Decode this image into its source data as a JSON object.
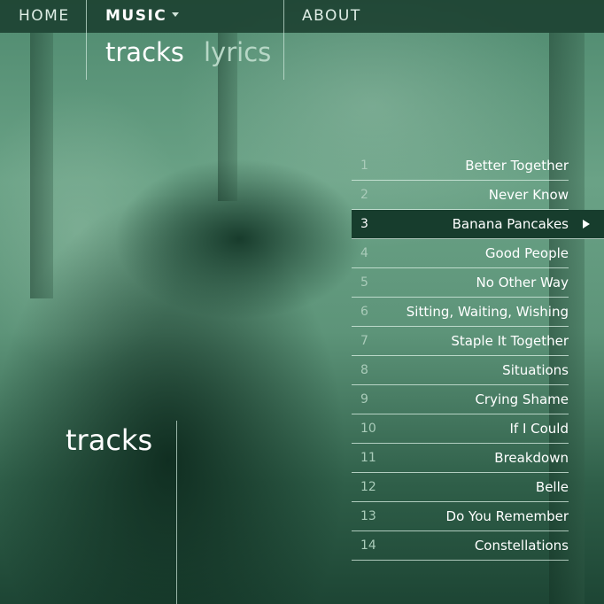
{
  "nav": {
    "home": "HOME",
    "music": "MUSIC",
    "about": "ABOUT"
  },
  "subtabs": {
    "tracks": "tracks",
    "lyrics": "lyrics",
    "selected": "tracks"
  },
  "section_title": "tracks",
  "tracks": [
    {
      "num": "1",
      "title": "Better Together"
    },
    {
      "num": "2",
      "title": "Never Know"
    },
    {
      "num": "3",
      "title": "Banana Pancakes"
    },
    {
      "num": "4",
      "title": "Good People"
    },
    {
      "num": "5",
      "title": "No Other Way"
    },
    {
      "num": "6",
      "title": "Sitting, Waiting, Wishing"
    },
    {
      "num": "7",
      "title": "Staple It Together"
    },
    {
      "num": "8",
      "title": "Situations"
    },
    {
      "num": "9",
      "title": "Crying Shame"
    },
    {
      "num": "10",
      "title": "If I Could"
    },
    {
      "num": "11",
      "title": "Breakdown"
    },
    {
      "num": "12",
      "title": "Belle"
    },
    {
      "num": "13",
      "title": "Do You Remember"
    },
    {
      "num": "14",
      "title": "Constellations"
    }
  ],
  "active_track": "3",
  "colors": {
    "tint": "#3f7a60",
    "nav_bar": "#193c2d",
    "active_row": "#173d2d",
    "text": "#ffffff"
  }
}
